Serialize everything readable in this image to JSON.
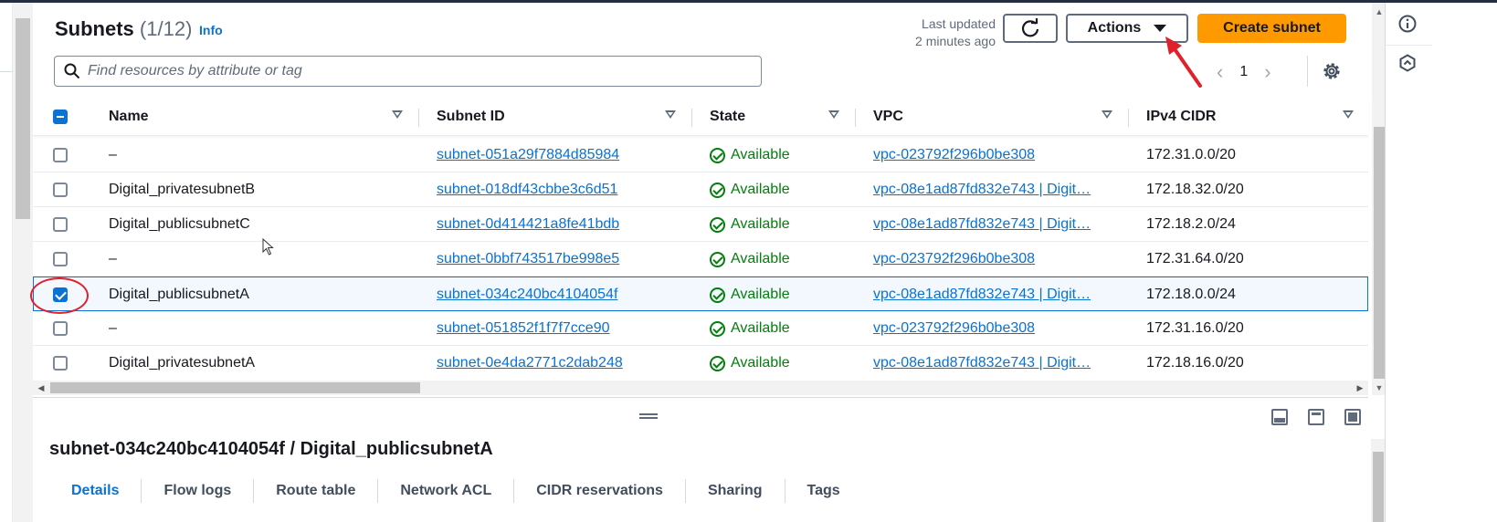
{
  "header": {
    "title": "Subnets",
    "count": "(1/12)",
    "info": "Info",
    "last_updated_line1": "Last updated",
    "last_updated_line2": "2 minutes ago",
    "actions_label": "Actions",
    "create_label": "Create subnet",
    "search_placeholder": "Find resources by attribute or tag",
    "page_number": "1"
  },
  "table": {
    "columns": [
      "Name",
      "Subnet ID",
      "State",
      "VPC",
      "IPv4 CIDR"
    ],
    "rows": [
      {
        "name": "–",
        "subnet_id": "subnet-051a29f7884d85984",
        "state": "Available",
        "vpc": "vpc-023792f296b0be308",
        "cidr": "172.31.0.0/20",
        "selected": false
      },
      {
        "name": "Digital_privatesubnetB",
        "subnet_id": "subnet-018df43cbbe3c6d51",
        "state": "Available",
        "vpc": "vpc-08e1ad87fd832e743 | Digit…",
        "cidr": "172.18.32.0/20",
        "selected": false
      },
      {
        "name": "Digital_publicsubnetC",
        "subnet_id": "subnet-0d414421a8fe41bdb",
        "state": "Available",
        "vpc": "vpc-08e1ad87fd832e743 | Digit…",
        "cidr": "172.18.2.0/24",
        "selected": false
      },
      {
        "name": "–",
        "subnet_id": "subnet-0bbf743517be998e5",
        "state": "Available",
        "vpc": "vpc-023792f296b0be308",
        "cidr": "172.31.64.0/20",
        "selected": false
      },
      {
        "name": "Digital_publicsubnetA",
        "subnet_id": "subnet-034c240bc4104054f",
        "state": "Available",
        "vpc": "vpc-08e1ad87fd832e743 | Digit…",
        "cidr": "172.18.0.0/24",
        "selected": true
      },
      {
        "name": "–",
        "subnet_id": "subnet-051852f1f7f7cce90",
        "state": "Available",
        "vpc": "vpc-023792f296b0be308",
        "cidr": "172.31.16.0/20",
        "selected": false
      },
      {
        "name": "Digital_privatesubnetA",
        "subnet_id": "subnet-0e4da2771c2dab248",
        "state": "Available",
        "vpc": "vpc-08e1ad87fd832e743 | Digit…",
        "cidr": "172.18.16.0/20",
        "selected": false
      }
    ]
  },
  "details": {
    "title": "subnet-034c240bc4104054f / Digital_publicsubnetA",
    "tabs": [
      "Details",
      "Flow logs",
      "Route table",
      "Network ACL",
      "CIDR reservations",
      "Sharing",
      "Tags"
    ],
    "active_tab": "Details"
  },
  "icons": {
    "refresh": "refresh-icon",
    "settings": "gear-icon",
    "search": "search-icon",
    "rail_info": "info-icon",
    "rail_hex": "hexagon-icon"
  },
  "colors": {
    "primary": "#ff9900",
    "link": "#0972d3",
    "success": "#037f0c",
    "annotation": "#e0202b"
  }
}
